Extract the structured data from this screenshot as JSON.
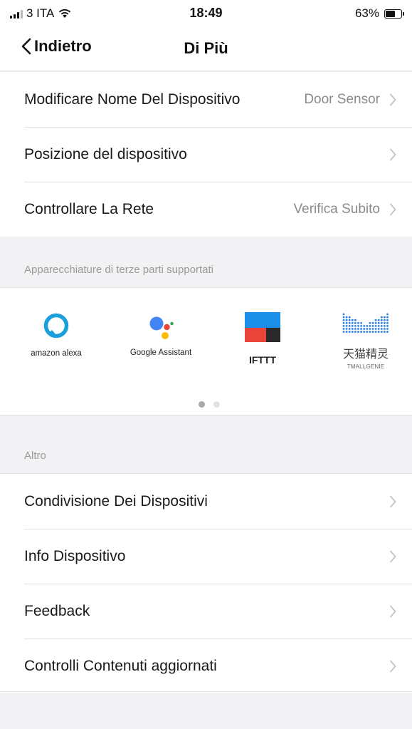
{
  "status_bar": {
    "carrier": "3 ITA",
    "time": "18:49",
    "battery": "63%",
    "battery_level": 0.63
  },
  "nav": {
    "back_label": "Indietro",
    "title": "Di Più"
  },
  "settings": [
    {
      "label": "Modificare Nome Del Dispositivo",
      "value": "Door Sensor"
    },
    {
      "label": "Posizione del dispositivo",
      "value": ""
    },
    {
      "label": "Controllare La Rete",
      "value": "Verifica Subito"
    }
  ],
  "third_party": {
    "section_label": "Apparecchiature di terze parti supportati",
    "items": [
      {
        "label": "amazon alexa",
        "icon": "amazon-alexa-icon"
      },
      {
        "label": "Google Assistant",
        "icon": "google-assistant-icon"
      },
      {
        "label": "IFTTT",
        "icon": "ifttt-icon"
      },
      {
        "label": "天猫精灵",
        "sublabel": "TMALLGENIE",
        "icon": "tmall-genie-icon"
      }
    ],
    "page_count": 2,
    "current_page": 1
  },
  "other": {
    "section_label": "Altro",
    "items": [
      {
        "label": "Condivisione Dei Dispositivi"
      },
      {
        "label": "Info Dispositivo"
      },
      {
        "label": "Feedback"
      },
      {
        "label": "Controlli Contenuti aggiornati"
      }
    ]
  }
}
